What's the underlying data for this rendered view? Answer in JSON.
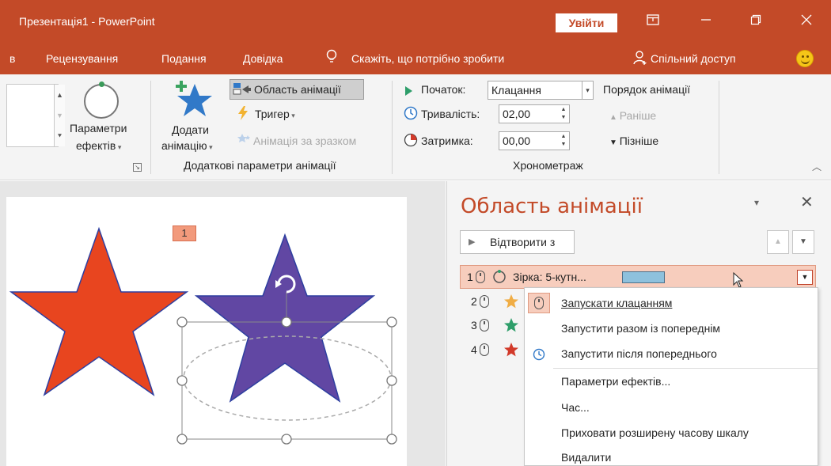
{
  "window": {
    "title": "Презентація1 - PowerPoint",
    "signin_label": "Увійти",
    "ribbon_display_icon": "ribbon-display-options-icon",
    "minimize_icon": "minimize-icon",
    "restore_icon": "restore-icon",
    "close_icon": "close-icon"
  },
  "tabs": {
    "cut_tab": "в",
    "review": "Рецензування",
    "slideshow": "Подання",
    "help": "Довідка",
    "tell_me": "Скажіть, що потрібно зробити",
    "share": "Спільний доступ",
    "smiley_icon": "smiley-icon"
  },
  "ribbon": {
    "effect_options_line1": "Параметри",
    "effect_options_line2": "ефектів",
    "add_animation_line1": "Додати",
    "add_animation_line2": "анімацію",
    "animation_pane": "Область анімації",
    "trigger": "Тригер",
    "animation_painter": "Анімація за зразком",
    "group_advanced": "Додаткові параметри анімації",
    "start_label": "Початок:",
    "start_value": "Клацання",
    "duration_label": "Тривалість:",
    "duration_value": "02,00",
    "delay_label": "Затримка:",
    "delay_value": "00,00",
    "group_timing": "Хронометраж",
    "reorder_title": "Порядок анімації",
    "move_earlier": "Раніше",
    "move_later": "Пізніше"
  },
  "slide": {
    "animation_tag": "1",
    "colors": {
      "red_star": "#e8451f",
      "purple_star": "#6147a3",
      "star_outline": "#2e3fa0"
    }
  },
  "pane": {
    "title": "Область анімації",
    "play_from": "Відтворити з",
    "items": [
      {
        "number": "1",
        "label": "Зірка: 5-кутн...",
        "bar_color": "#8ec1dd"
      },
      {
        "number": "2",
        "star_color": "#f0ad45"
      },
      {
        "number": "3",
        "star_color": "#2e9e6a"
      },
      {
        "number": "4",
        "star_color": "#d23a2a"
      }
    ]
  },
  "menu": {
    "start_on_click": "Запускати клацанням",
    "start_with_previous": "Запустити разом із попереднім",
    "start_after_previous": "Запустити після попереднього",
    "effect_options": "Параметри ефектів...",
    "timing": "Час...",
    "hide_timeline": "Приховати розширену часову шкалу",
    "remove": "Видалити"
  }
}
